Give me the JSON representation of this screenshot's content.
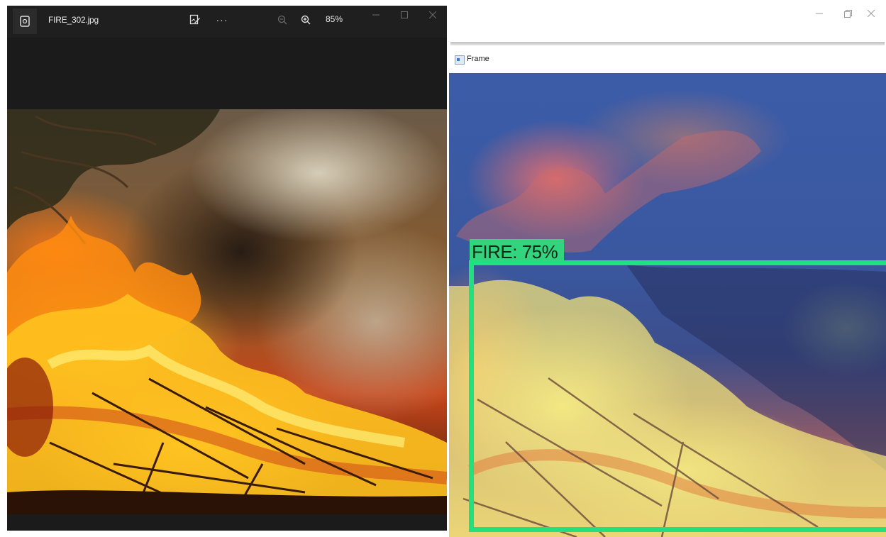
{
  "viewer": {
    "file_name": "FIRE_302.jpg",
    "zoom_level": "85%",
    "icons": {
      "app": "photo-app-icon",
      "edit": "edit-image-icon",
      "more": "more-options-icon",
      "zoom_out": "zoom-out-icon",
      "zoom_in": "zoom-in-icon"
    },
    "more_glyph": "···"
  },
  "frame": {
    "title": "Frame",
    "detection": {
      "label": "FIRE: 75%",
      "box_color": "#22e07e",
      "label_bg_color": "#33d47e"
    }
  }
}
